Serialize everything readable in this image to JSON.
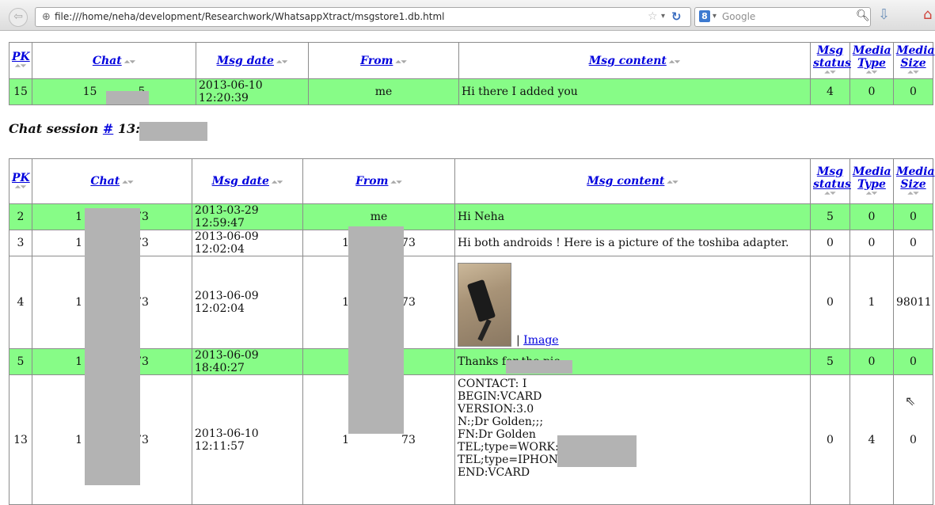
{
  "browser": {
    "url": "file:///home/neha/development/Researchwork/WhatsappXtract/msgstore1.db.html",
    "search_placeholder": "Google",
    "search_engine_letter": "8"
  },
  "columns": [
    "PK",
    "Chat",
    "Msg date",
    "From",
    "Msg content",
    "Msg status",
    "Media Type",
    "Media Size"
  ],
  "column_lines": {
    "msg_status": [
      "Msg",
      "status"
    ],
    "media_type": [
      "Media",
      "Type"
    ],
    "media_size": [
      "Media",
      "Size"
    ]
  },
  "table1": {
    "rows": [
      {
        "pk": "15",
        "chat": "15",
        "chat_end": "5",
        "date": "2013-06-10 12:20:39",
        "from": "me",
        "content": "Hi there I added you",
        "status": "4",
        "media_type": "0",
        "media_size": "0",
        "highlight": true
      }
    ]
  },
  "session": {
    "label": "Chat session ",
    "hash": "#",
    "number": " 13: 1"
  },
  "table2": {
    "rows": [
      {
        "pk": "2",
        "chat": "1",
        "chat_end": "73",
        "date": "2013-03-29 12:59:47",
        "from": "me",
        "content": "Hi Neha",
        "status": "5",
        "media_type": "0",
        "media_size": "0",
        "highlight": true
      },
      {
        "pk": "3",
        "chat": "1",
        "chat_end": "73",
        "date": "2013-06-09 12:02:04",
        "from": "1",
        "from_end": "73",
        "content": "Hi both androids ! Here is a picture of the toshiba adapter.",
        "status": "0",
        "media_type": "0",
        "media_size": "0",
        "highlight": false
      },
      {
        "pk": "4",
        "chat": "1",
        "chat_end": "73",
        "date": "2013-06-09 12:02:04",
        "from": "1",
        "from_end": "73",
        "content_sep": "| ",
        "content_link": "Image",
        "status": "0",
        "media_type": "1",
        "media_size": "98011",
        "highlight": false
      },
      {
        "pk": "5",
        "chat": "1",
        "chat_end": "73",
        "date": "2013-06-09 18:40:27",
        "from": "",
        "content": "Thanks for the pic",
        "status": "5",
        "media_type": "0",
        "media_size": "0",
        "highlight": true
      },
      {
        "pk": "13",
        "chat": "1",
        "chat_end": "73",
        "date": "2013-06-10 12:11:57",
        "from": "1",
        "from_end": "73",
        "content_lines": [
          "CONTACT: I",
          "BEGIN:VCARD",
          "VERSION:3.0",
          "N:;Dr Golden;;;",
          "FN:Dr Golden",
          "TEL;type=WORK:(5",
          "TEL;type=IPHONE:",
          "END:VCARD"
        ],
        "status": "0",
        "media_type": "4",
        "media_size": "0",
        "highlight": false
      }
    ]
  },
  "colors": {
    "highlight_row": "#87fc87",
    "link": "#0000dd",
    "redaction": "#b3b3b3"
  }
}
